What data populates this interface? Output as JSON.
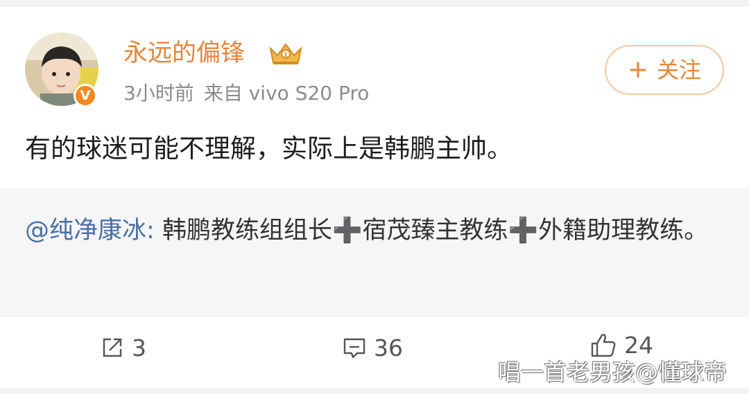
{
  "author": {
    "name": "永远的偏锋",
    "verified_badge": "V",
    "time": "3小时前",
    "source": "来自 vivo S20 Pro",
    "badge_icon": "crown-icon"
  },
  "follow": {
    "plus": "+",
    "label": "关注"
  },
  "post": {
    "text": "有的球迷可能不理解，实际上是韩鹏主帅。"
  },
  "repost": {
    "mention": "@纯净康冰",
    "separator": ": ",
    "part1": "韩鹏教练组组长",
    "plus1": "➕",
    "part2": "宿茂臻主教练",
    "plus2": "➕",
    "part3": "外籍助理教练。"
  },
  "actions": {
    "repost_count": "3",
    "comment_count": "36",
    "like_count": "24"
  },
  "watermark": "唱一首老男孩@懂球帝",
  "colors": {
    "accent": "#e8843a",
    "mention": "#4a6fa5",
    "repost_bg": "#f6f6f6"
  }
}
